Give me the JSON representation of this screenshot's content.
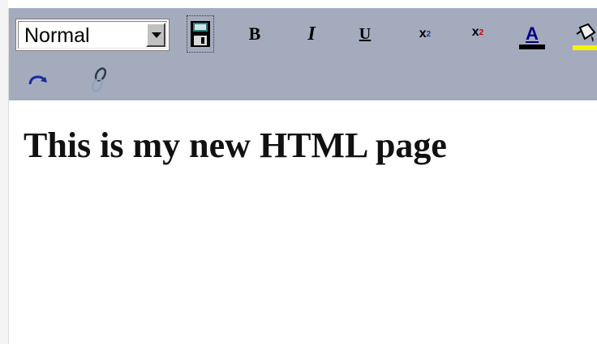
{
  "toolbar": {
    "style_select": {
      "value": "Normal"
    },
    "buttons": {
      "bold": "B",
      "italic": "I",
      "underline": "U",
      "subscript_base": "x",
      "subscript_script": "2",
      "superscript_base": "x",
      "superscript_script": "2",
      "font_color_letter": "A"
    },
    "icons": [
      "save-icon",
      "redo-icon",
      "link-icon",
      "highlight-icon",
      "font-color-icon"
    ],
    "colors": {
      "toolbar_bg": "#a4abbd",
      "font_color_bar": "#000000",
      "highlight_bar": "#f6f200"
    }
  },
  "editor": {
    "heading": "This is my new HTML page"
  }
}
